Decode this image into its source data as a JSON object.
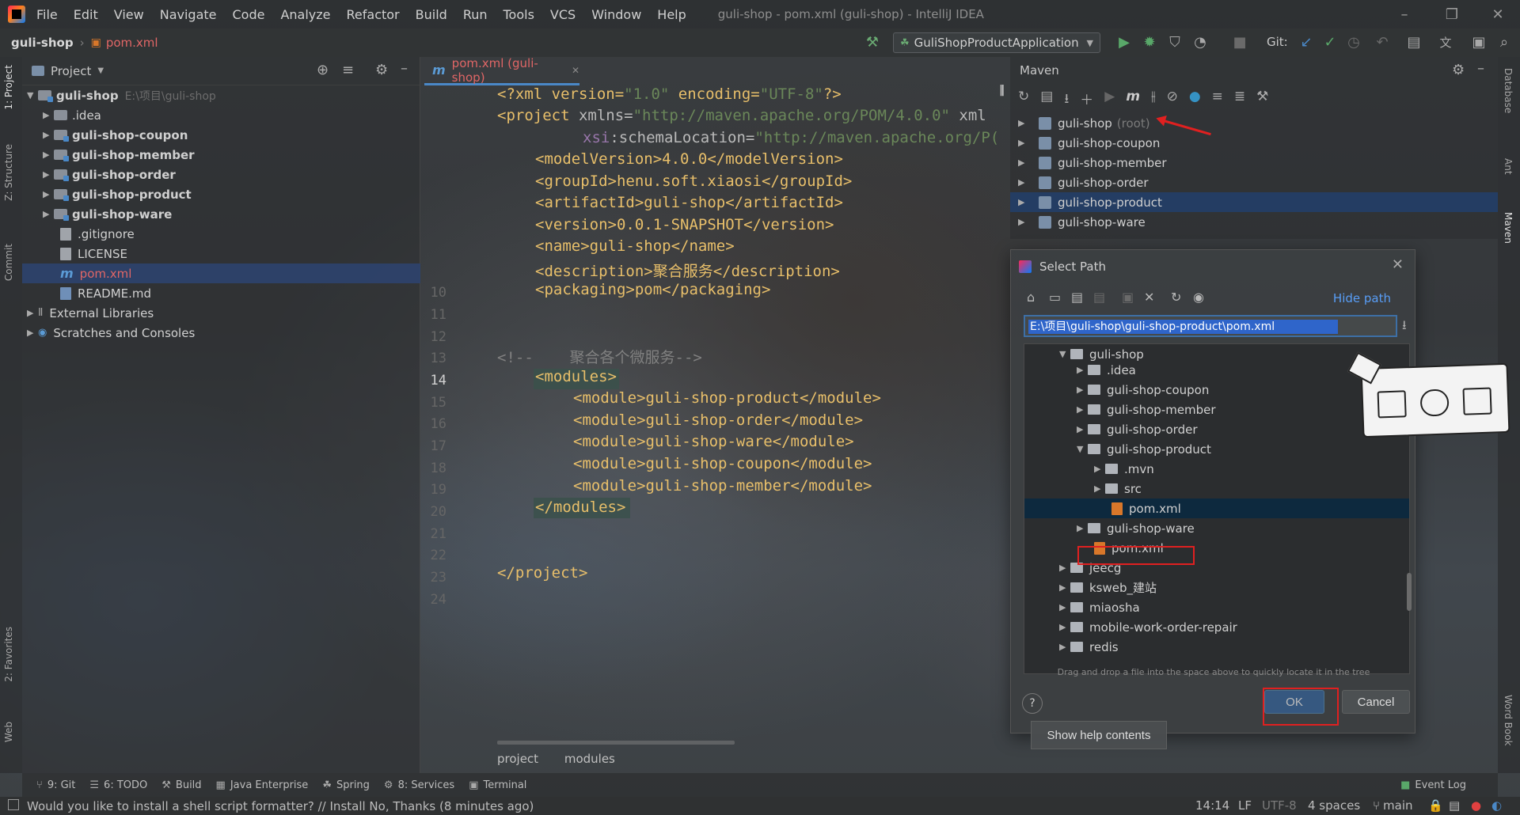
{
  "menubar": {
    "items": [
      "File",
      "Edit",
      "View",
      "Navigate",
      "Code",
      "Analyze",
      "Refactor",
      "Build",
      "Run",
      "Tools",
      "VCS",
      "Window",
      "Help"
    ],
    "window_title": "guli-shop - pom.xml (guli-shop) - IntelliJ IDEA"
  },
  "navbar": {
    "project": "guli-shop",
    "file": "pom.xml",
    "run_config": "GuliShopProductApplication",
    "git_label": "Git:"
  },
  "left_strip": {
    "project": "1: Project",
    "structure": "Z: Structure",
    "commit": "Commit",
    "favorites": "2: Favorites",
    "web": "Web"
  },
  "right_strip": {
    "database": "Database",
    "ant": "Ant",
    "maven": "Maven",
    "wordbook": "Word Book"
  },
  "project_panel": {
    "header": "Project",
    "root": "guli-shop",
    "root_path": "E:\\项目\\guli-shop",
    "items": [
      ".idea",
      "guli-shop-coupon",
      "guli-shop-member",
      "guli-shop-order",
      "guli-shop-product",
      "guli-shop-ware"
    ],
    "files": [
      ".gitignore",
      "LICENSE",
      "pom.xml",
      "README.md"
    ],
    "external": "External Libraries",
    "scratches": "Scratches and Consoles"
  },
  "editor": {
    "tab": "pom.xml (guli-shop)",
    "line_numbers": [
      "10",
      "11",
      "12",
      "13",
      "14",
      "15",
      "16",
      "17",
      "18",
      "19",
      "20",
      "21",
      "22",
      "23",
      "24"
    ],
    "lines": {
      "l1_a": "<?xml version=",
      "l1_b": "\"1.0\"",
      "l1_c": " encoding=",
      "l1_d": "\"UTF-8\"",
      "l1_e": "?>",
      "l2_a": "<project",
      "l2_b": " xmlns=",
      "l2_c": "\"http://maven.apache.org/POM/4.0.0\"",
      "l2_d": " xml",
      "l3_a": "xsi",
      "l3_b": ":schemaLocation=",
      "l3_c": "\"http://maven.apache.org/P(",
      "l4": "<modelVersion>4.0.0</modelVersion>",
      "l5": "<groupId>henu.soft.xiaosi</groupId>",
      "l6": "<artifactId>guli-shop</artifactId>",
      "l7": "<version>0.0.1-SNAPSHOT</version>",
      "l8": "<name>guli-shop</name>",
      "l9": "<description>聚合服务</description>",
      "l10": "<packaging>pom</packaging>",
      "l13": "<!--    聚合各个微服务-->",
      "l14": "<modules>",
      "l15": "<module>guli-shop-product</module>",
      "l16": "<module>guli-shop-order</module>",
      "l17": "<module>guli-shop-ware</module>",
      "l18": "<module>guli-shop-coupon</module>",
      "l19": "<module>guli-shop-member</module>",
      "l20": "</modules>",
      "l23": "</project>"
    },
    "breadcrumb": [
      "project",
      "modules"
    ]
  },
  "maven": {
    "title": "Maven",
    "items": [
      {
        "label": "guli-shop",
        "suffix": "(root)"
      },
      {
        "label": "guli-shop-coupon"
      },
      {
        "label": "guli-shop-member"
      },
      {
        "label": "guli-shop-order"
      },
      {
        "label": "guli-shop-product"
      },
      {
        "label": "guli-shop-ware"
      }
    ]
  },
  "dialog": {
    "title": "Select Path",
    "hide_path": "Hide path",
    "path_value": "E:\\项目\\guli-shop\\guli-shop-product\\pom.xml",
    "tree": {
      "root": "guli-shop",
      "children": [
        ".idea",
        "guli-shop-coupon",
        "guli-shop-member",
        "guli-shop-order",
        "guli-shop-product"
      ],
      "product_children": [
        ".mvn",
        "src",
        "pom.xml"
      ],
      "after": [
        "guli-shop-ware",
        "pom.xml"
      ],
      "siblings": [
        "jeecg",
        "ksweb_建站",
        "miaosha",
        "mobile-work-order-repair",
        "redis"
      ]
    },
    "hint": "Drag and drop a file into the space above to quickly locate it in the tree",
    "help_symbol": "?",
    "ok": "OK",
    "cancel": "Cancel"
  },
  "help_contents": "Show help contents",
  "bottom_tools": {
    "items": [
      "9: Git",
      "6: TODO",
      "Build",
      "Java Enterprise",
      "Spring",
      "8: Services",
      "Terminal"
    ],
    "event_log": "Event Log"
  },
  "status": {
    "message": "Would you like to install a shell script formatter? // Install   No, Thanks (8 minutes ago)",
    "position": "14:14",
    "line_sep": "LF",
    "encoding": "UTF-8",
    "indent": "4 spaces",
    "branch": "main"
  },
  "colors": {
    "accent_blue": "#4a88c7",
    "link_blue": "#589df6",
    "annotation_red": "#e02020",
    "xml_tag": "#e8bf6a",
    "xml_string": "#6a8759"
  }
}
